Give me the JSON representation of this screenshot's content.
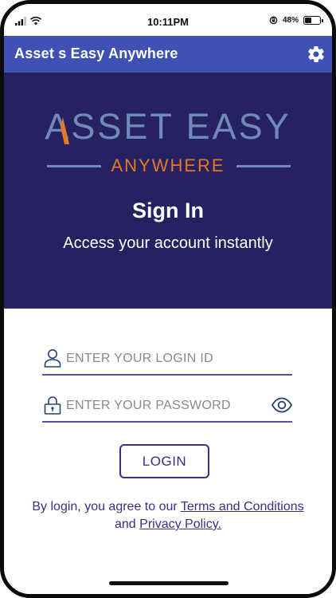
{
  "status_bar": {
    "time": "10:11PM",
    "battery_text": "48%",
    "battery_level": 0.48,
    "icons": [
      "signal-icon",
      "wifi-icon",
      "orientation-lock-icon",
      "battery-icon"
    ]
  },
  "app_bar": {
    "title": "Asset s Easy Anywhere",
    "settings_icon": "gear-icon",
    "background": "#3f51b5"
  },
  "hero": {
    "logo_main": "ASSET EASY",
    "logo_sub": "ANYWHERE",
    "title": "Sign In",
    "subtitle": "Access your account instantly",
    "background": "#262262",
    "logo_color": "#6f89b8",
    "accent_color": "#e87722"
  },
  "form": {
    "login_id": {
      "value": "",
      "placeholder": "ENTER YOUR LOGIN ID",
      "icon": "user-icon"
    },
    "password": {
      "value": "",
      "placeholder": "ENTER YOUR PASSWORD",
      "icon": "lock-icon",
      "toggle_icon": "eye-icon"
    },
    "login_label": "LOGIN",
    "terms": {
      "prefix": "By login, you agree to our ",
      "terms_link": "Terms and Conditions",
      "middle": " and ",
      "privacy_link": "Privacy Policy."
    },
    "accent_color": "#3b2f86"
  }
}
